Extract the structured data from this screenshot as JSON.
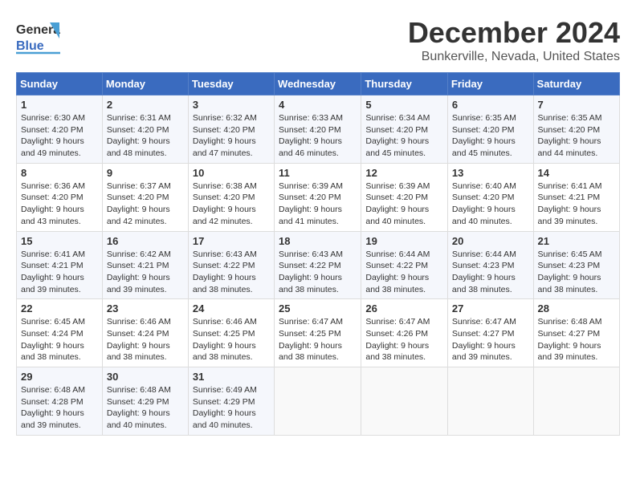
{
  "header": {
    "logo_general": "General",
    "logo_blue": "Blue",
    "main_title": "December 2024",
    "subtitle": "Bunkerville, Nevada, United States"
  },
  "calendar": {
    "weekdays": [
      "Sunday",
      "Monday",
      "Tuesday",
      "Wednesday",
      "Thursday",
      "Friday",
      "Saturday"
    ],
    "weeks": [
      [
        {
          "day": "1",
          "sunrise": "6:30 AM",
          "sunset": "4:20 PM",
          "daylight": "9 hours and 49 minutes."
        },
        {
          "day": "2",
          "sunrise": "6:31 AM",
          "sunset": "4:20 PM",
          "daylight": "9 hours and 48 minutes."
        },
        {
          "day": "3",
          "sunrise": "6:32 AM",
          "sunset": "4:20 PM",
          "daylight": "9 hours and 47 minutes."
        },
        {
          "day": "4",
          "sunrise": "6:33 AM",
          "sunset": "4:20 PM",
          "daylight": "9 hours and 46 minutes."
        },
        {
          "day": "5",
          "sunrise": "6:34 AM",
          "sunset": "4:20 PM",
          "daylight": "9 hours and 45 minutes."
        },
        {
          "day": "6",
          "sunrise": "6:35 AM",
          "sunset": "4:20 PM",
          "daylight": "9 hours and 45 minutes."
        },
        {
          "day": "7",
          "sunrise": "6:35 AM",
          "sunset": "4:20 PM",
          "daylight": "9 hours and 44 minutes."
        }
      ],
      [
        {
          "day": "8",
          "sunrise": "6:36 AM",
          "sunset": "4:20 PM",
          "daylight": "9 hours and 43 minutes."
        },
        {
          "day": "9",
          "sunrise": "6:37 AM",
          "sunset": "4:20 PM",
          "daylight": "9 hours and 42 minutes."
        },
        {
          "day": "10",
          "sunrise": "6:38 AM",
          "sunset": "4:20 PM",
          "daylight": "9 hours and 42 minutes."
        },
        {
          "day": "11",
          "sunrise": "6:39 AM",
          "sunset": "4:20 PM",
          "daylight": "9 hours and 41 minutes."
        },
        {
          "day": "12",
          "sunrise": "6:39 AM",
          "sunset": "4:20 PM",
          "daylight": "9 hours and 40 minutes."
        },
        {
          "day": "13",
          "sunrise": "6:40 AM",
          "sunset": "4:20 PM",
          "daylight": "9 hours and 40 minutes."
        },
        {
          "day": "14",
          "sunrise": "6:41 AM",
          "sunset": "4:21 PM",
          "daylight": "9 hours and 39 minutes."
        }
      ],
      [
        {
          "day": "15",
          "sunrise": "6:41 AM",
          "sunset": "4:21 PM",
          "daylight": "9 hours and 39 minutes."
        },
        {
          "day": "16",
          "sunrise": "6:42 AM",
          "sunset": "4:21 PM",
          "daylight": "9 hours and 39 minutes."
        },
        {
          "day": "17",
          "sunrise": "6:43 AM",
          "sunset": "4:22 PM",
          "daylight": "9 hours and 38 minutes."
        },
        {
          "day": "18",
          "sunrise": "6:43 AM",
          "sunset": "4:22 PM",
          "daylight": "9 hours and 38 minutes."
        },
        {
          "day": "19",
          "sunrise": "6:44 AM",
          "sunset": "4:22 PM",
          "daylight": "9 hours and 38 minutes."
        },
        {
          "day": "20",
          "sunrise": "6:44 AM",
          "sunset": "4:23 PM",
          "daylight": "9 hours and 38 minutes."
        },
        {
          "day": "21",
          "sunrise": "6:45 AM",
          "sunset": "4:23 PM",
          "daylight": "9 hours and 38 minutes."
        }
      ],
      [
        {
          "day": "22",
          "sunrise": "6:45 AM",
          "sunset": "4:24 PM",
          "daylight": "9 hours and 38 minutes."
        },
        {
          "day": "23",
          "sunrise": "6:46 AM",
          "sunset": "4:24 PM",
          "daylight": "9 hours and 38 minutes."
        },
        {
          "day": "24",
          "sunrise": "6:46 AM",
          "sunset": "4:25 PM",
          "daylight": "9 hours and 38 minutes."
        },
        {
          "day": "25",
          "sunrise": "6:47 AM",
          "sunset": "4:25 PM",
          "daylight": "9 hours and 38 minutes."
        },
        {
          "day": "26",
          "sunrise": "6:47 AM",
          "sunset": "4:26 PM",
          "daylight": "9 hours and 38 minutes."
        },
        {
          "day": "27",
          "sunrise": "6:47 AM",
          "sunset": "4:27 PM",
          "daylight": "9 hours and 39 minutes."
        },
        {
          "day": "28",
          "sunrise": "6:48 AM",
          "sunset": "4:27 PM",
          "daylight": "9 hours and 39 minutes."
        }
      ],
      [
        {
          "day": "29",
          "sunrise": "6:48 AM",
          "sunset": "4:28 PM",
          "daylight": "9 hours and 39 minutes."
        },
        {
          "day": "30",
          "sunrise": "6:48 AM",
          "sunset": "4:29 PM",
          "daylight": "9 hours and 40 minutes."
        },
        {
          "day": "31",
          "sunrise": "6:49 AM",
          "sunset": "4:29 PM",
          "daylight": "9 hours and 40 minutes."
        },
        null,
        null,
        null,
        null
      ]
    ]
  },
  "labels": {
    "sunrise_label": "Sunrise:",
    "sunset_label": "Sunset:",
    "daylight_label": "Daylight:"
  }
}
